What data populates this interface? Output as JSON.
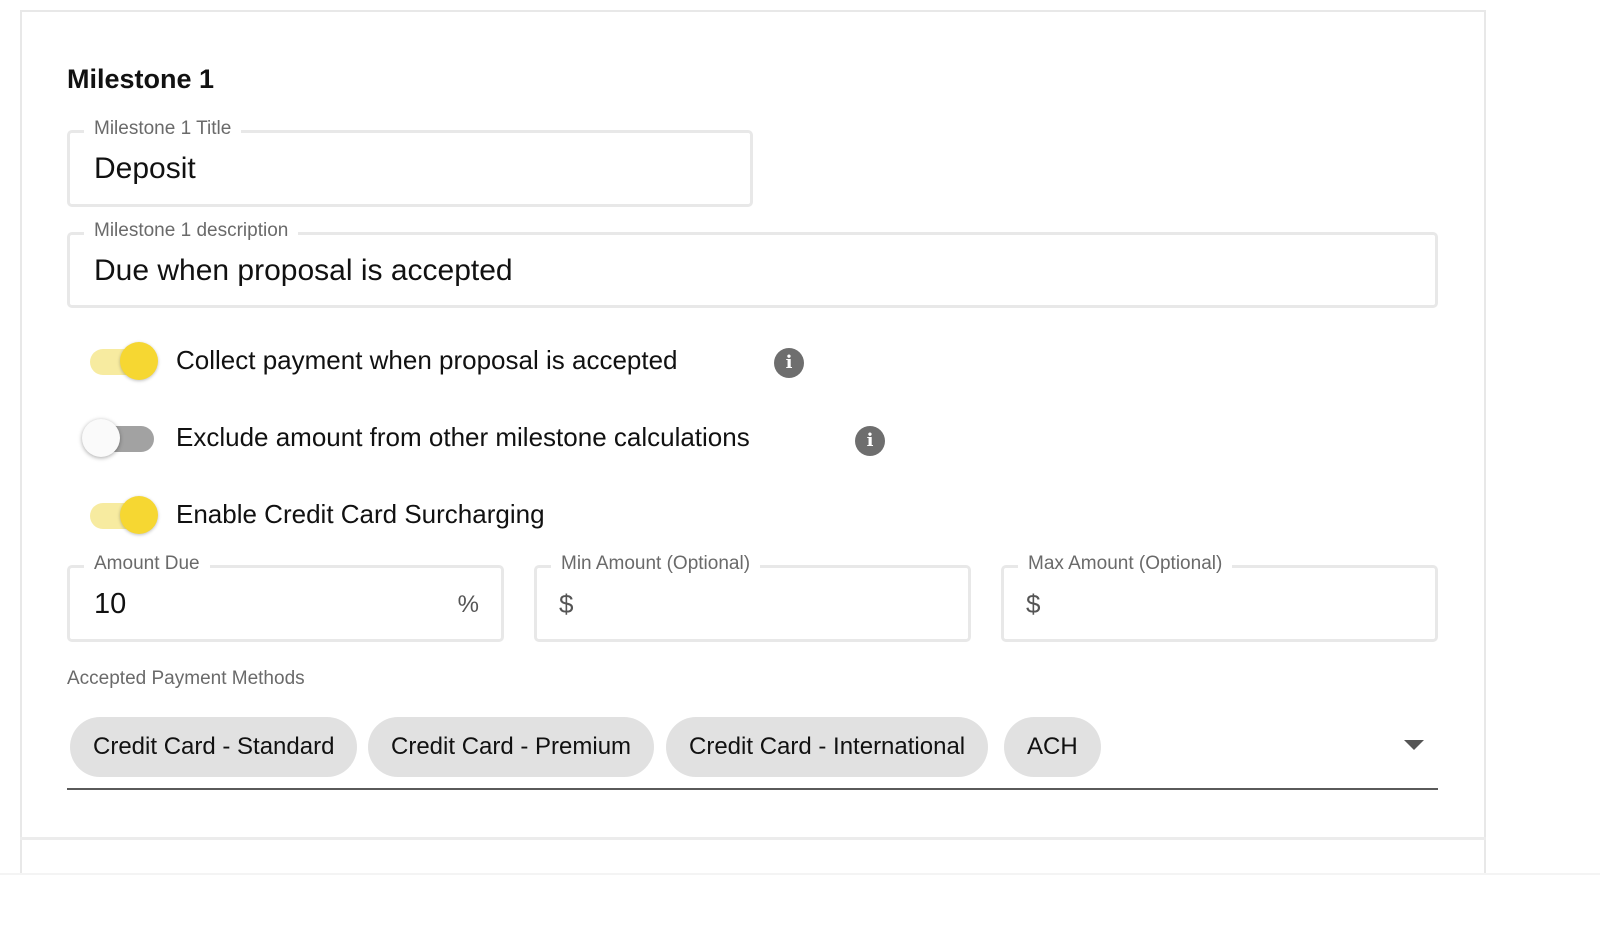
{
  "milestone": {
    "heading": "Milestone 1",
    "title_field": {
      "label": "Milestone 1 Title",
      "value": "Deposit"
    },
    "description_field": {
      "label": "Milestone 1 description",
      "value": "Due when proposal is accepted"
    }
  },
  "toggles": [
    {
      "label": "Collect payment when proposal is accepted",
      "on": true,
      "has_info": true
    },
    {
      "label": "Exclude amount from other milestone calculations",
      "on": false,
      "has_info": true
    },
    {
      "label": "Enable Credit Card Surcharging",
      "on": true,
      "has_info": false
    }
  ],
  "amount_fields": {
    "amount_due": {
      "label": "Amount Due",
      "value": "10",
      "suffix": "%"
    },
    "min_amount": {
      "label": "Min Amount (Optional)",
      "prefix": "$",
      "value": ""
    },
    "max_amount": {
      "label": "Max Amount (Optional)",
      "prefix": "$",
      "value": ""
    }
  },
  "payment_methods": {
    "label": "Accepted Payment Methods",
    "selected": [
      "Credit Card - Standard",
      "Credit Card - Premium",
      "Credit Card - International",
      "ACH"
    ]
  },
  "icons": {
    "info": "info-icon",
    "dropdown": "chevron-down-icon"
  },
  "colors": {
    "toggle_on_thumb": "#f6d732",
    "toggle_on_track": "#f7eba0",
    "toggle_off_track": "#a2a2a2",
    "chip_bg": "#e1e1e1",
    "info_icon": "#6e6e6e"
  }
}
